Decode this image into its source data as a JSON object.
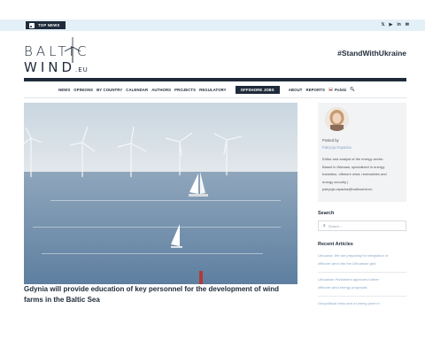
{
  "topbar": {
    "top_news_label": "TOP NEWS",
    "social_icons": [
      "twitter-icon",
      "youtube-icon",
      "linkedin-icon",
      "mail-icon"
    ]
  },
  "logo": {
    "line1": "BALTIC",
    "line2": "WIND",
    "line2_suffix": ".EU"
  },
  "hashtag": "#StandWithUkraine",
  "nav": {
    "items": [
      "NEWS",
      "OPINIONS",
      "BY COUNTRY",
      "CALENDAR",
      "AUTHORS",
      "PROJECTS",
      "REGULATORY",
      "OFFSHORE JOBS",
      "ABOUT",
      "REPORTS"
    ],
    "language": "Polski"
  },
  "article": {
    "headline": "Gdynia will provide education of key personnel for the development of wind farms in the Baltic Sea"
  },
  "author_box": {
    "posted_by": "Posted by",
    "name": "Patrycja Rapacka",
    "bio_lines": [
      "Editor and analyst of the energy sector.",
      "Based in Warsaw, specialised in energy",
      "transition, offshore wind, renewables and",
      "energy security |",
      "patrycja.rapacka@balticwind.eu"
    ]
  },
  "search": {
    "title": "Search",
    "placeholder": "Search..."
  },
  "recent": {
    "title": "Recent Articles",
    "articles": [
      {
        "lines": [
          "Lithuania: We are preparing for integration of",
          "offshore wind into the Lithuanian grid"
        ]
      },
      {
        "lines": [
          "Lithuanian Parliament approves further",
          "offshore wind energy proposals"
        ]
      },
      {
        "lines": [
          "Geopolitical crisis and a turning point in"
        ]
      }
    ]
  },
  "colors": {
    "brand_navy": "#1f2b3a",
    "topbar_bg": "#e4f0f8",
    "link_blue": "#8aa8c8"
  }
}
